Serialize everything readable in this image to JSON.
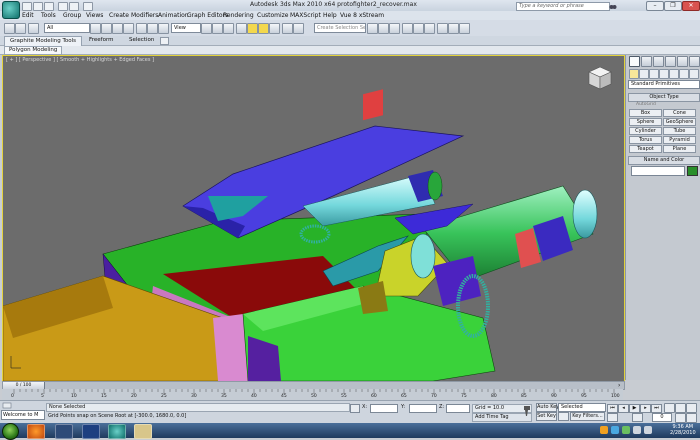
{
  "window": {
    "title": "Autodesk 3ds Max 2010 x64     protofighter2_recover.max",
    "search_placeholder": "Type a keyword or phrase",
    "controls": [
      "–",
      "❐",
      "✕"
    ]
  },
  "menu": [
    "Edit",
    "Tools",
    "Group",
    "Views",
    "Create",
    "Modifiers",
    "Animation",
    "Graph Editors",
    "Rendering",
    "Customize",
    "MAXScript",
    "Help",
    "Vue 8 xStream"
  ],
  "toolbar": {
    "selection_filter": "All",
    "reference_coord": "View",
    "named_selection_placeholder": "Create Selection Se"
  },
  "ribbon": {
    "tabs": [
      "Graphite Modeling Tools",
      "Freeform",
      "Selection"
    ],
    "active_tab": "Graphite Modeling Tools",
    "panel_button": "Polygon Modeling"
  },
  "viewport": {
    "label": "[ + ] [ Perspective ] [ Smooth + Highlights + Edged Faces ]"
  },
  "command_panel": {
    "category": "Standard Primitives",
    "object_type_title": "Object Type",
    "autogrid_label": "AutoGrid",
    "primitives": [
      "Box",
      "Cone",
      "Sphere",
      "GeoSphere",
      "Cylinder",
      "Tube",
      "Torus",
      "Pyramid",
      "Teapot",
      "Plane"
    ],
    "name_color_title": "Name and Color",
    "object_color": "#2a8f2a"
  },
  "timeline": {
    "slider_label": "0 / 100",
    "current_frame": 0,
    "total_frames": 100,
    "ticks": [
      "0",
      "5",
      "10",
      "15",
      "20",
      "25",
      "30",
      "35",
      "40",
      "45",
      "50",
      "55",
      "60",
      "65",
      "70",
      "75",
      "80",
      "85",
      "90",
      "95",
      "100"
    ]
  },
  "status": {
    "maxscript": "Welcome to M",
    "selection": "None Selected",
    "prompt": "Grid Points snap on Scene Root at [-300.0, 1680.0, 0.0]",
    "coord_labels": [
      "X:",
      "Y:",
      "Z:"
    ],
    "grid": "Grid = 10.0",
    "add_time_tag": "Add Time Tag",
    "auto_key": "Auto Key",
    "set_key": "Set Key",
    "key_mode": "Selected",
    "key_filters": "Key Filters...",
    "frame": "0"
  },
  "taskbar": {
    "time": "9:36 AM",
    "date": "2/28/2010"
  }
}
